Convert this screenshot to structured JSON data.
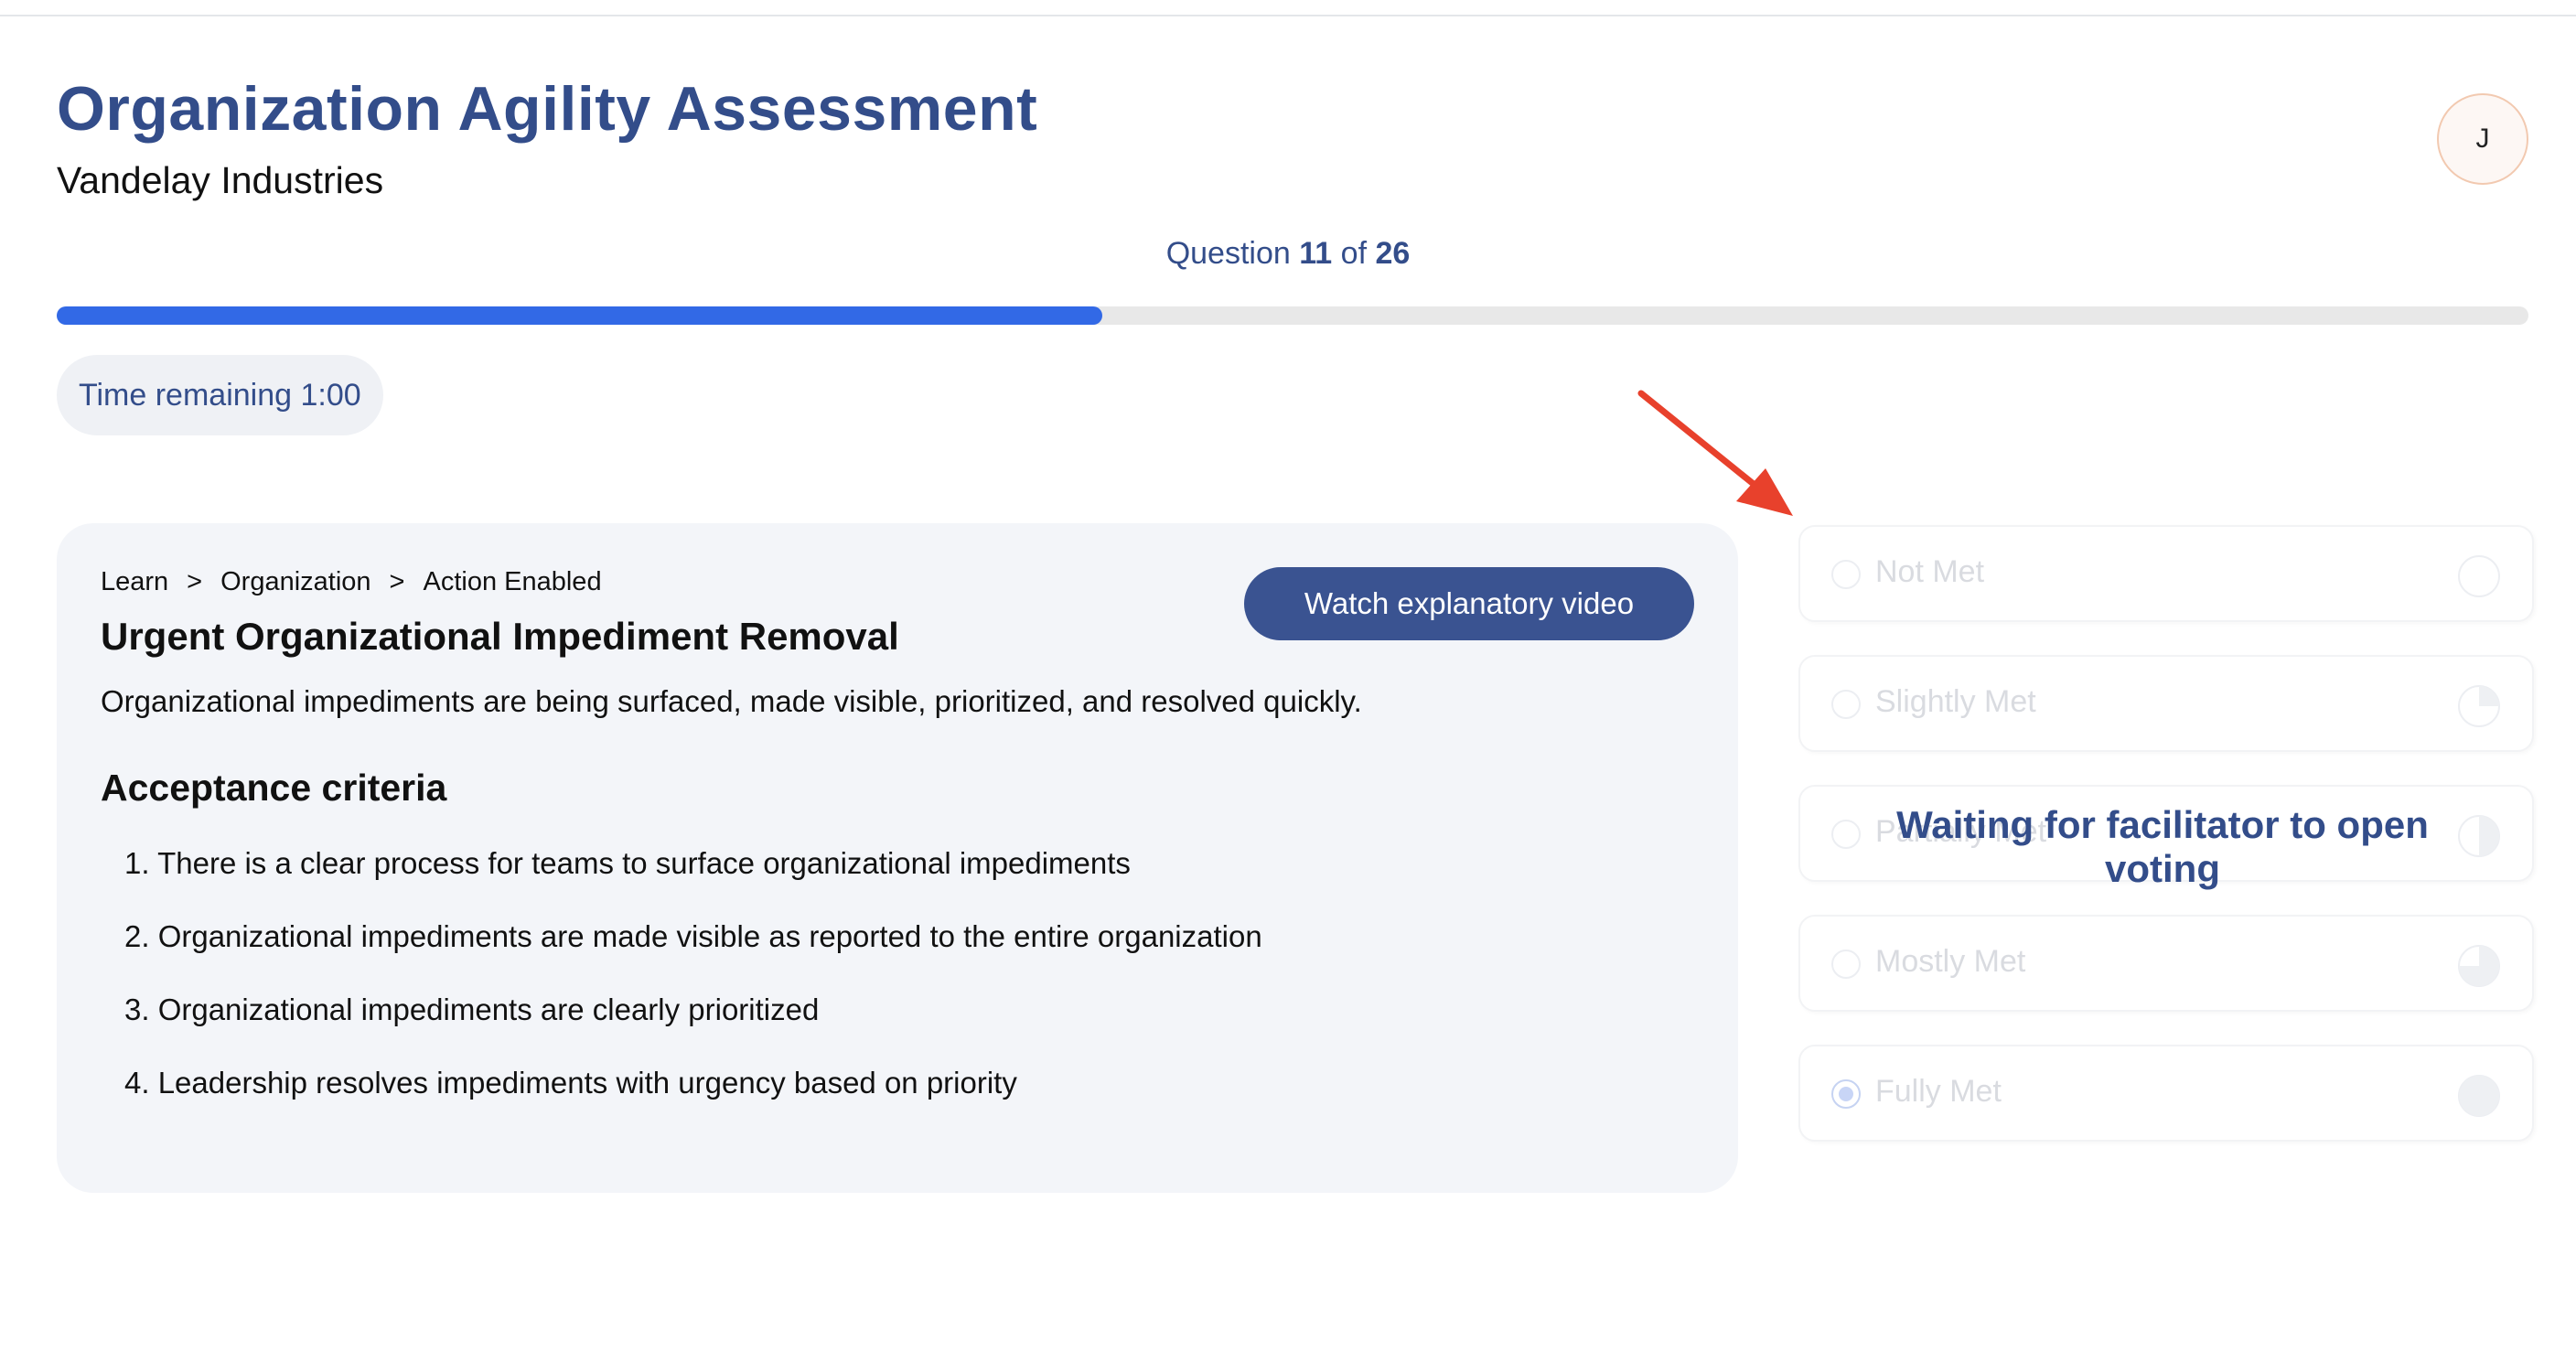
{
  "header": {
    "title": "Organization Agility Assessment",
    "organization": "Vandelay Industries",
    "avatar_initial": "J"
  },
  "progress": {
    "question_prefix": "Question",
    "current": "11",
    "of_label": "of",
    "total": "26",
    "fraction_complete": 0.423,
    "color": "#3269e6"
  },
  "timer": {
    "label": "Time remaining 1:00"
  },
  "item": {
    "breadcrumb": [
      "Learn",
      "Organization",
      "Action Enabled"
    ],
    "breadcrumb_separator": ">",
    "title": "Urgent Organizational Impediment Removal",
    "description": "Organizational impediments are being surfaced, made visible, prioritized, and resolved quickly.",
    "watch_video_label": "Watch explanatory video",
    "criteria_heading": "Acceptance criteria",
    "criteria": [
      "1. There is a clear process for teams to surface organizational impediments",
      "2. Organizational impediments are made visible as reported to the entire organization",
      "3. Organizational impediments are clearly prioritized",
      "4. Leadership resolves impediments with urgency based on priority"
    ]
  },
  "voting": {
    "options": [
      {
        "label": "Not Met",
        "fill": 0
      },
      {
        "label": "Slightly Met",
        "fill": 0.25
      },
      {
        "label": "Partially Met",
        "fill": 0.5
      },
      {
        "label": "Mostly Met",
        "fill": 0.75
      },
      {
        "label": "Fully Met",
        "fill": 1
      }
    ],
    "selected_index": 4,
    "overlay_message": "Waiting for facilitator to open voting",
    "disabled": true
  },
  "colors": {
    "brand": "#334d8a",
    "button": "#3a5391",
    "annotation_arrow": "#e8412c"
  },
  "icons": {
    "annotation": "red-arrow-icon"
  }
}
